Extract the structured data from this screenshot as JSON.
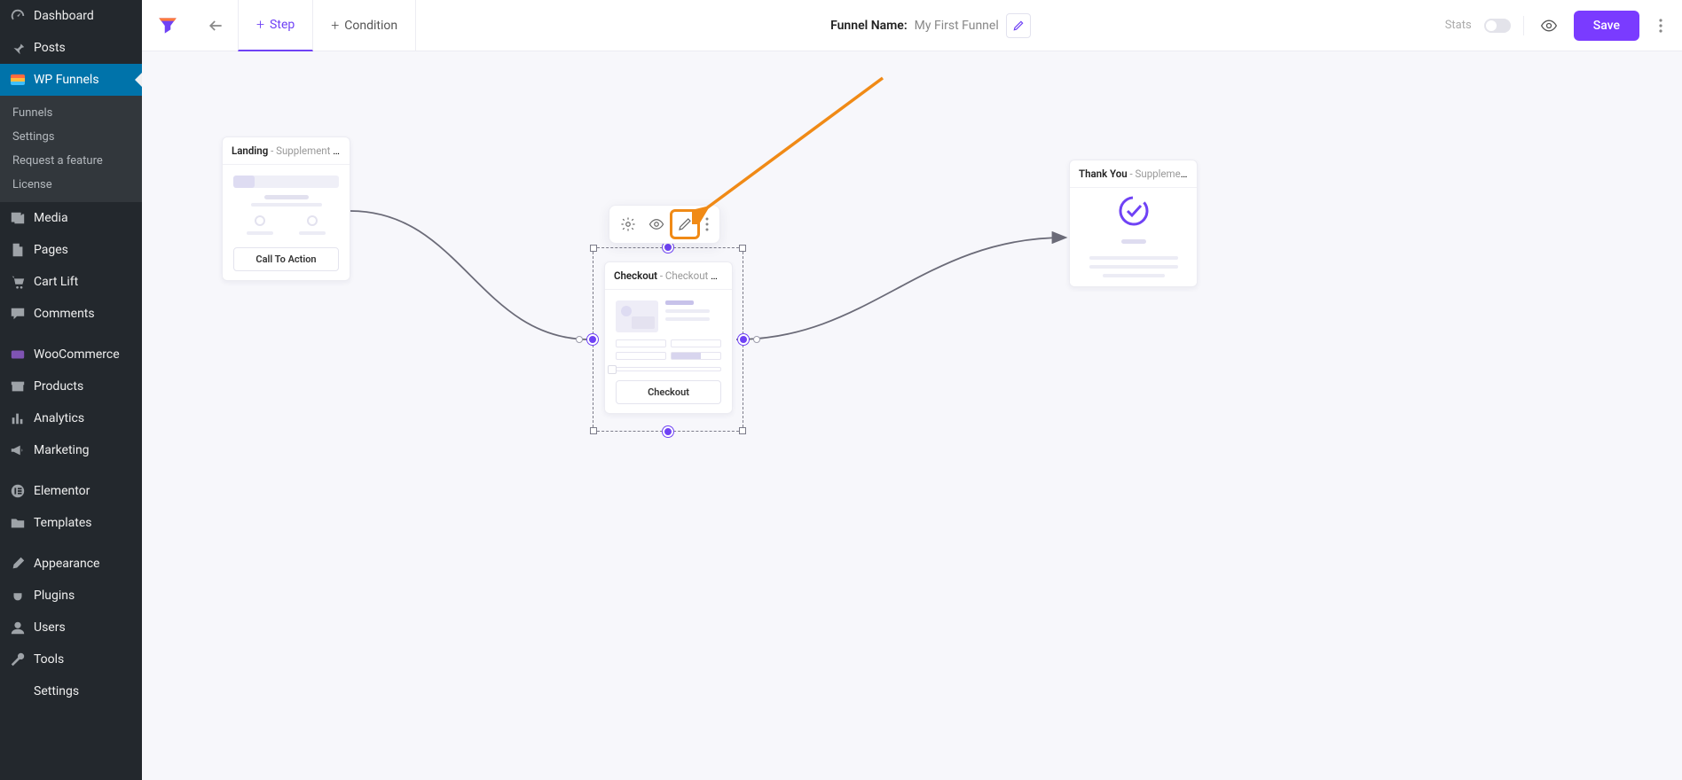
{
  "sidebar": {
    "dashboard": "Dashboard",
    "posts": "Posts",
    "wpfunnels": "WP Funnels",
    "sub": {
      "funnels": "Funnels",
      "settings": "Settings",
      "request": "Request a feature",
      "license": "License"
    },
    "media": "Media",
    "pages": "Pages",
    "cartlift": "Cart Lift",
    "comments": "Comments",
    "woocommerce": "WooCommerce",
    "products": "Products",
    "analytics": "Analytics",
    "marketing": "Marketing",
    "elementor": "Elementor",
    "templates": "Templates",
    "appearance": "Appearance",
    "plugins": "Plugins",
    "users": "Users",
    "tools": "Tools",
    "settings2": "Settings"
  },
  "topbar": {
    "step_tab": "Step",
    "condition_tab": "Condition",
    "funnel_label": "Funnel Name:",
    "funnel_value": "My First Funnel",
    "stats_label": "Stats",
    "save": "Save"
  },
  "steps": {
    "landing": {
      "type": "Landing",
      "name": "Supplement La...",
      "cta": "Call To Action"
    },
    "checkout": {
      "type": "Checkout",
      "name": "Checkout Step",
      "cta": "Checkout"
    },
    "thankyou": {
      "type": "Thank You",
      "name": "Supplement T..."
    }
  },
  "colors": {
    "accent": "#7a3bff",
    "highlight": "#f08a16"
  }
}
